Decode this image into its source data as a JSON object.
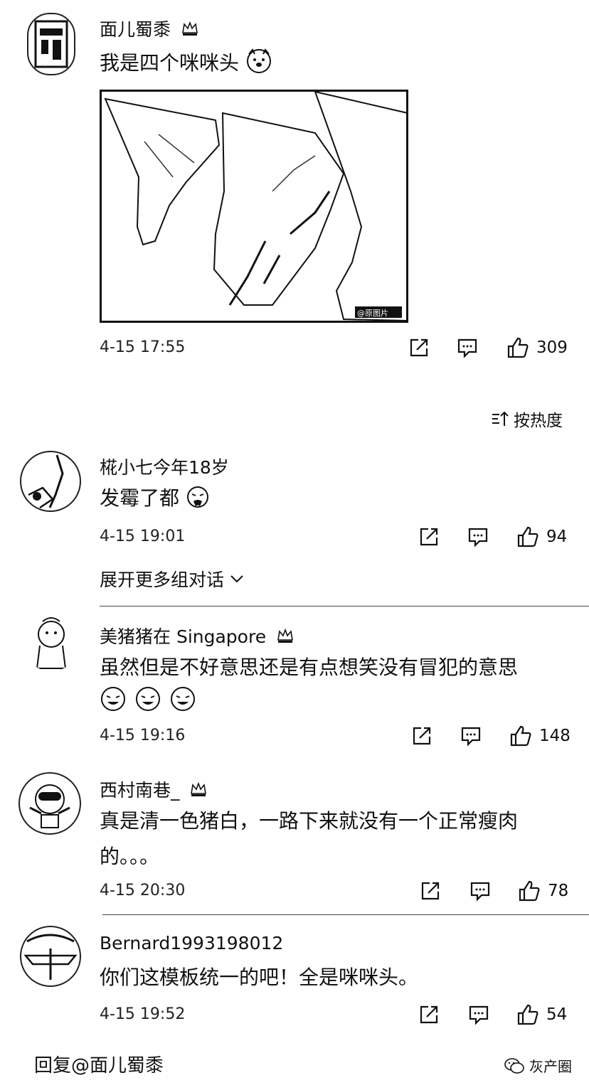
{
  "top_comment": {
    "username": "面儿蜀黍",
    "text": "我是四个咪咪头",
    "time": "4-15 17:55",
    "likes": "309",
    "image_watermark": "@原图片"
  },
  "sort": {
    "label": "按热度"
  },
  "comments": [
    {
      "username": "椛小七今年18岁",
      "text": "发霉了都",
      "time": "4-15 19:01",
      "likes": "94"
    },
    {
      "username": "美猪猪在 Singapore",
      "text": "虽然但是不好意思还是有点想笑没有冒犯的意思",
      "time": "4-15 19:16",
      "likes": "148"
    },
    {
      "username": "西村南巷_",
      "text": "真是清一色猪白，一路下来就没有一个正常瘦肉的。。。",
      "time": "4-15 20:30",
      "likes": "78"
    },
    {
      "username": "Bernard1993198012",
      "text": "你们这模板统一的吧！全是咪咪头。",
      "time": "4-15 19:52",
      "likes": "54"
    }
  ],
  "expand_label": "展开更多组对话",
  "reply_target": "回复@面儿蜀黍",
  "watermark": "灰产圈"
}
